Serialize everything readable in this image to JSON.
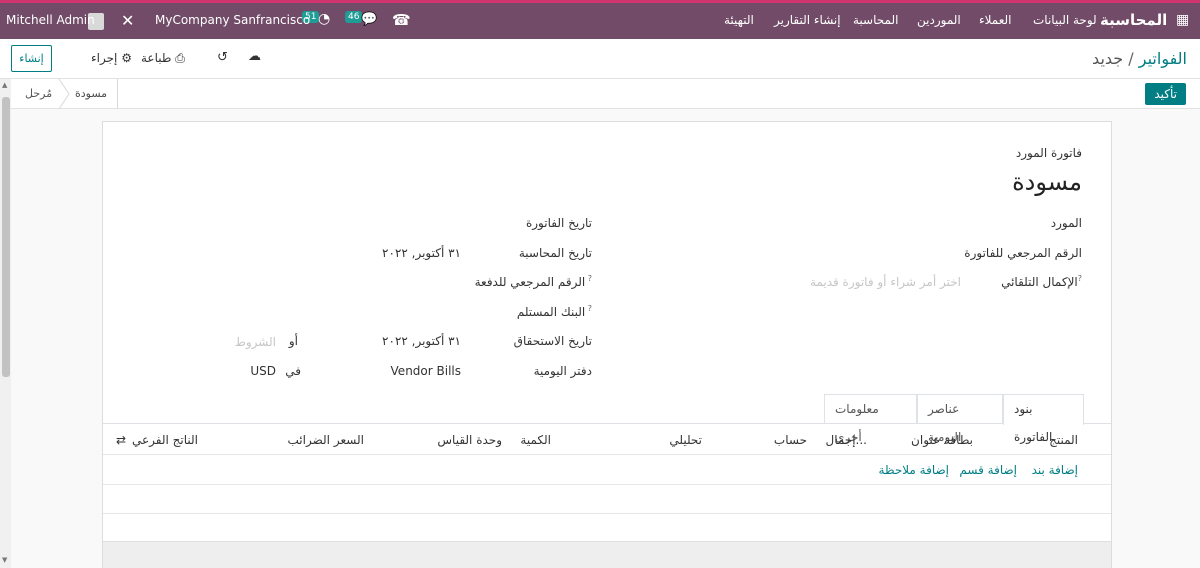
{
  "navbar": {
    "apps_icon": "grid-icon",
    "app_name": "المحاسبة",
    "menu": [
      "لوحة البيانات",
      "العملاء",
      "الموردين",
      "المحاسبة",
      "إنشاء التقارير",
      "التهيئة"
    ],
    "user": "Mitchell Admin",
    "company": "MyCompany Sanfrancisco",
    "activity_count": "51",
    "messages_count": "46"
  },
  "control": {
    "breadcrumb_parent": "الفواتير",
    "breadcrumb_sep": "/",
    "breadcrumb_current": "جديد",
    "create": "إنشاء",
    "print": "طباعة",
    "action": "إجراء"
  },
  "statusbar": {
    "confirm": "تأكيد",
    "stage_draft": "مسودة",
    "stage_posted": "مُرحل"
  },
  "form": {
    "bill_type": "فاتورة المورد",
    "title": "مسودة",
    "vendor_label": "المورد",
    "bill_ref_label": "الرقم المرجعي للفاتورة",
    "autocomplete_label": "الإكمال التلقائي",
    "autocomplete_placeholder": "اختر أمر شراء أو فاتورة قديمة",
    "bill_date_label": "تاريخ الفاتورة",
    "accounting_date_label": "تاريخ المحاسبة",
    "accounting_date_value": "٣١ أكتوبر, ٢٠٢٢",
    "payment_ref_label": "الرقم المرجعي للدفعة",
    "recipient_bank_label": "البنك المستلم",
    "due_date_label": "تاريخ الاستحقاق",
    "due_date_value": "٣١ أكتوبر, ٢٠٢٢",
    "or_label": "أو",
    "terms_placeholder": "الشروط",
    "journal_label": "دفتر اليومية",
    "journal_value": "Vendor Bills",
    "in_label": "في",
    "currency_value": "USD"
  },
  "tabs": [
    "بنود الفاتورة",
    "عناصر اليومية",
    "معلومات أخرى"
  ],
  "lines_table": {
    "headers": [
      "المنتج",
      "بطاقة عنوان",
      "إجمال...",
      "حساب",
      "تحليلي",
      "الكمية",
      "وحدة القياس",
      "السعر",
      "الضرائب",
      "الناتج الفرعي"
    ],
    "add_line": "إضافة بند",
    "add_section": "إضافة قسم",
    "add_note": "إضافة ملاحظة"
  },
  "colors": {
    "navbar_bg": "#714b67",
    "accent": "#017e84"
  }
}
